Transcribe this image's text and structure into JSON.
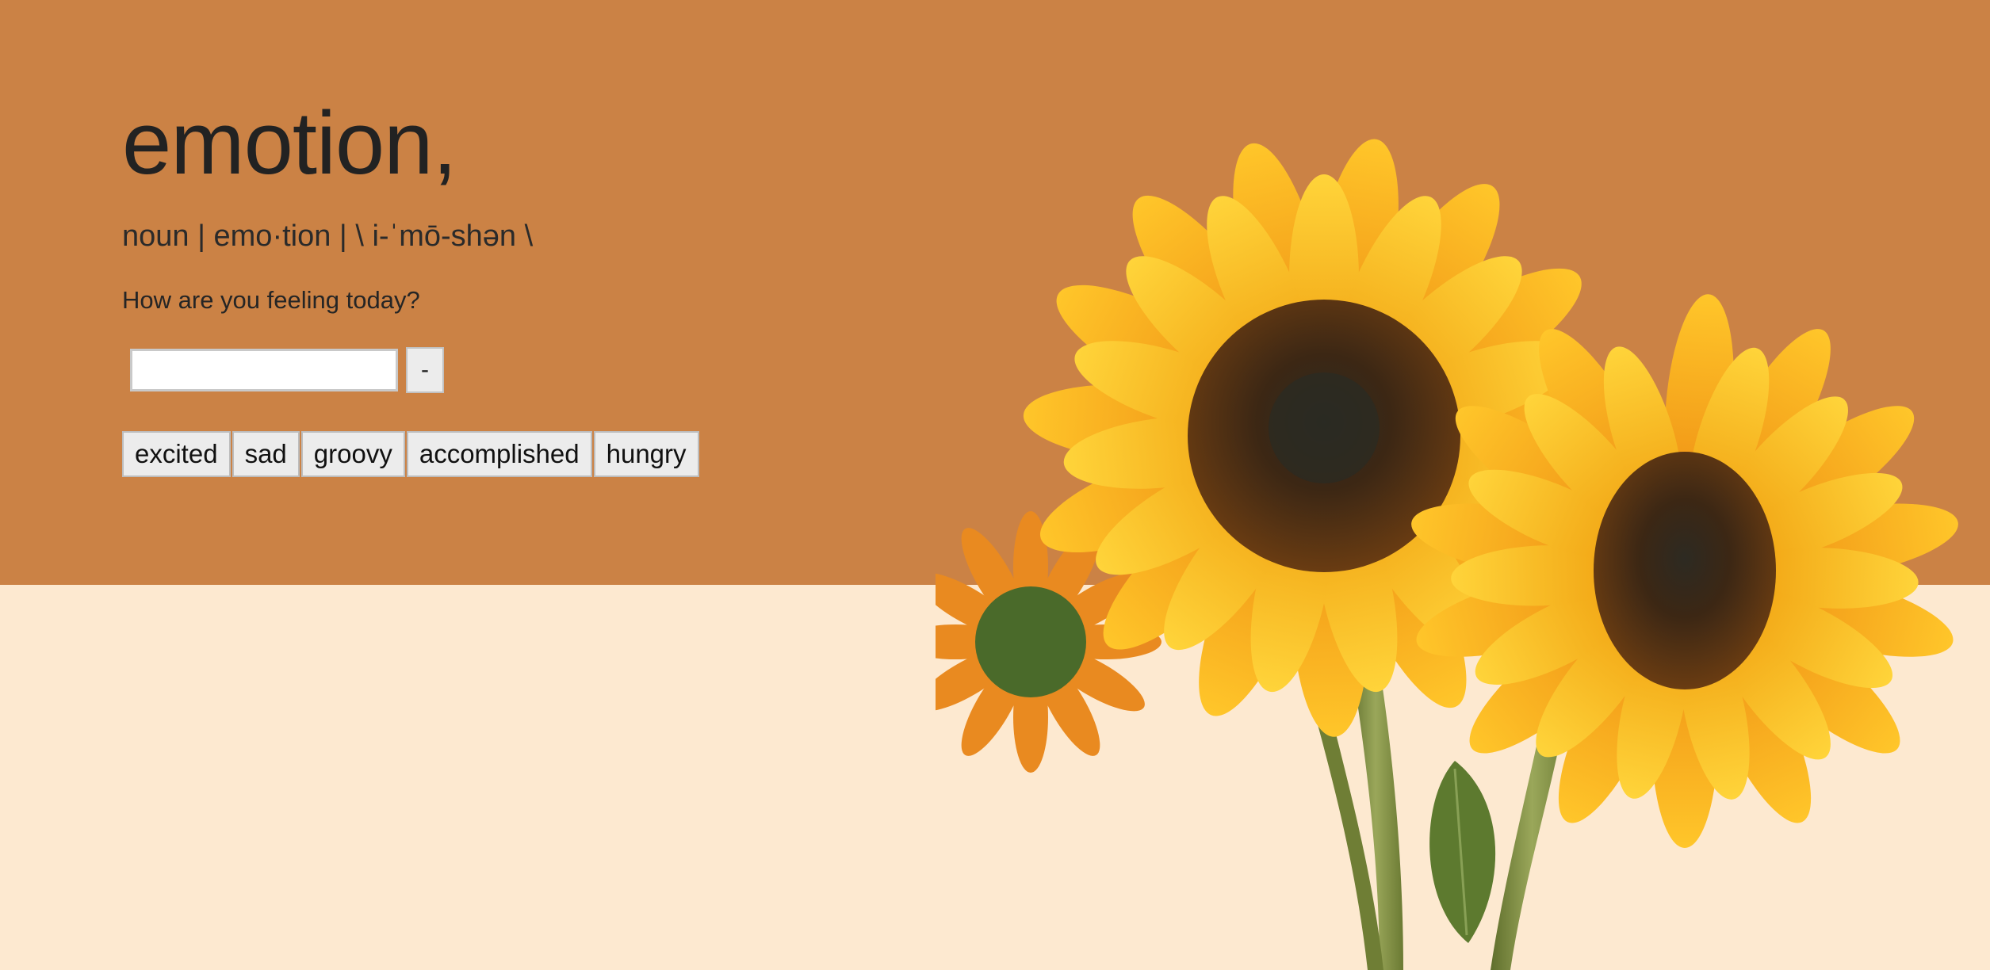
{
  "definition": {
    "word": "emotion,",
    "pronunciation": "noun | emo·tion | \\ i-ˈmō-shən \\",
    "question": "How are you feeling today?"
  },
  "entry": {
    "input_value": "",
    "input_placeholder": "",
    "minus_label": "-"
  },
  "emotions": [
    "excited",
    "sad",
    "groovy",
    "accomplished",
    "hungry"
  ],
  "colors": {
    "top_band": "#cb8245",
    "bottom_band": "#fde9d0",
    "petal": "#f6b81a",
    "petal_dark": "#e9891a",
    "center": "#3b2a1a",
    "stem": "#7a8a3e"
  },
  "image": {
    "icon": "sunflower-bouquet-illustration"
  }
}
